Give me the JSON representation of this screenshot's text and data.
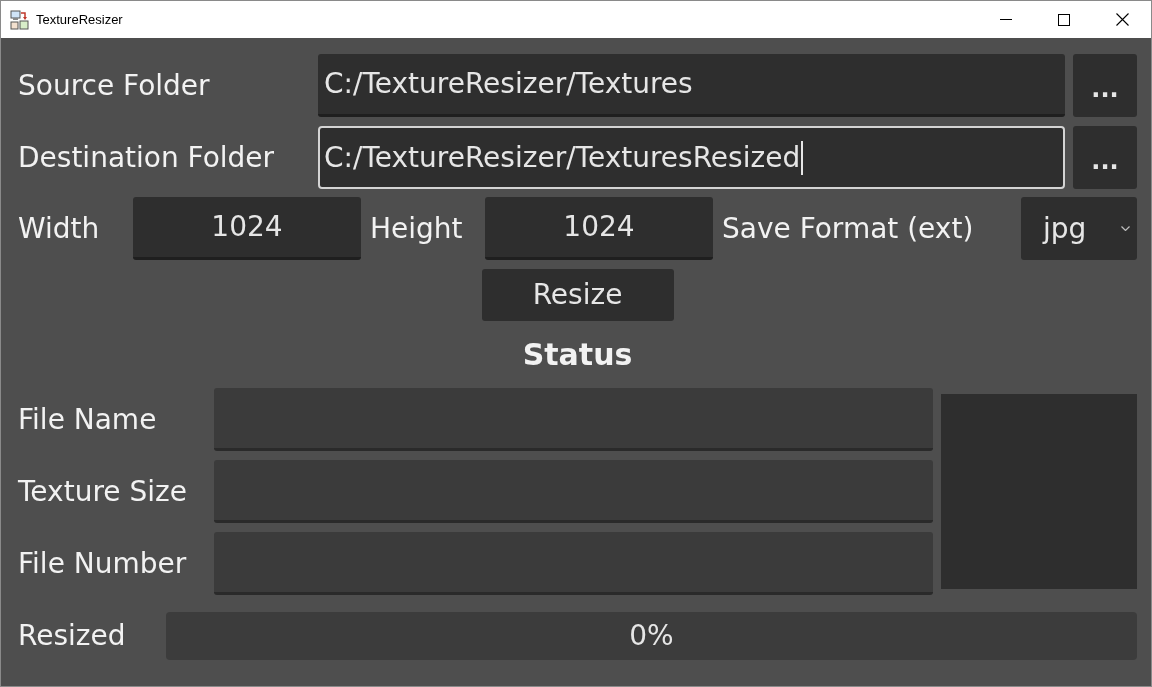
{
  "window": {
    "title": "TextureResizer"
  },
  "folders": [
    {
      "label": "Source Folder",
      "value": "C:/TextureResizer/Textures",
      "focused": false,
      "browse_button": "..."
    },
    {
      "label": "Destination Folder",
      "value": "C:/TextureResizer/TexturesResized",
      "focused": true,
      "browse_button": "..."
    }
  ],
  "size_settings": [
    {
      "kind": "field",
      "label": "Width",
      "value": "1024"
    },
    {
      "kind": "field",
      "label": "Height",
      "value": "1024"
    },
    {
      "kind": "dropdown",
      "label": "Save Format (ext)",
      "value": "jpg"
    }
  ],
  "resize_button": "Resize",
  "status": {
    "title": "Status",
    "fields": [
      {
        "label": "File Name"
      },
      {
        "label": "Texture Size"
      },
      {
        "label": "File Number"
      }
    ]
  },
  "progress": {
    "label": "Resized",
    "level": 0,
    "reading": "0%"
  }
}
